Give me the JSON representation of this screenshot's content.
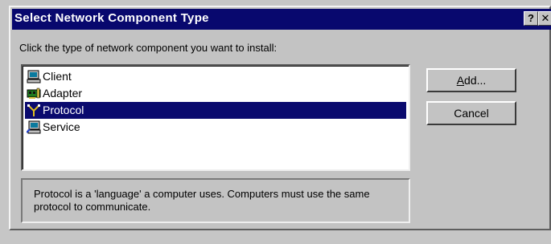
{
  "window": {
    "title": "Select Network Component Type",
    "help_label": "?",
    "close_label": "✕"
  },
  "prompt": "Click the type of network component you want to install:",
  "components": [
    {
      "label": "Client",
      "icon": "computer-icon",
      "selected": false
    },
    {
      "label": "Adapter",
      "icon": "network-card-icon",
      "selected": false
    },
    {
      "label": "Protocol",
      "icon": "protocol-icon",
      "selected": true
    },
    {
      "label": "Service",
      "icon": "service-icon",
      "selected": false
    }
  ],
  "buttons": {
    "add_accel": "A",
    "add_rest": "dd...",
    "cancel": "Cancel"
  },
  "description": "Protocol is a 'language' a computer uses. Computers must use the same protocol to communicate.",
  "colors": {
    "titlebar": "#08086e",
    "selection": "#0a0a6e",
    "face": "#c3c3c3"
  }
}
